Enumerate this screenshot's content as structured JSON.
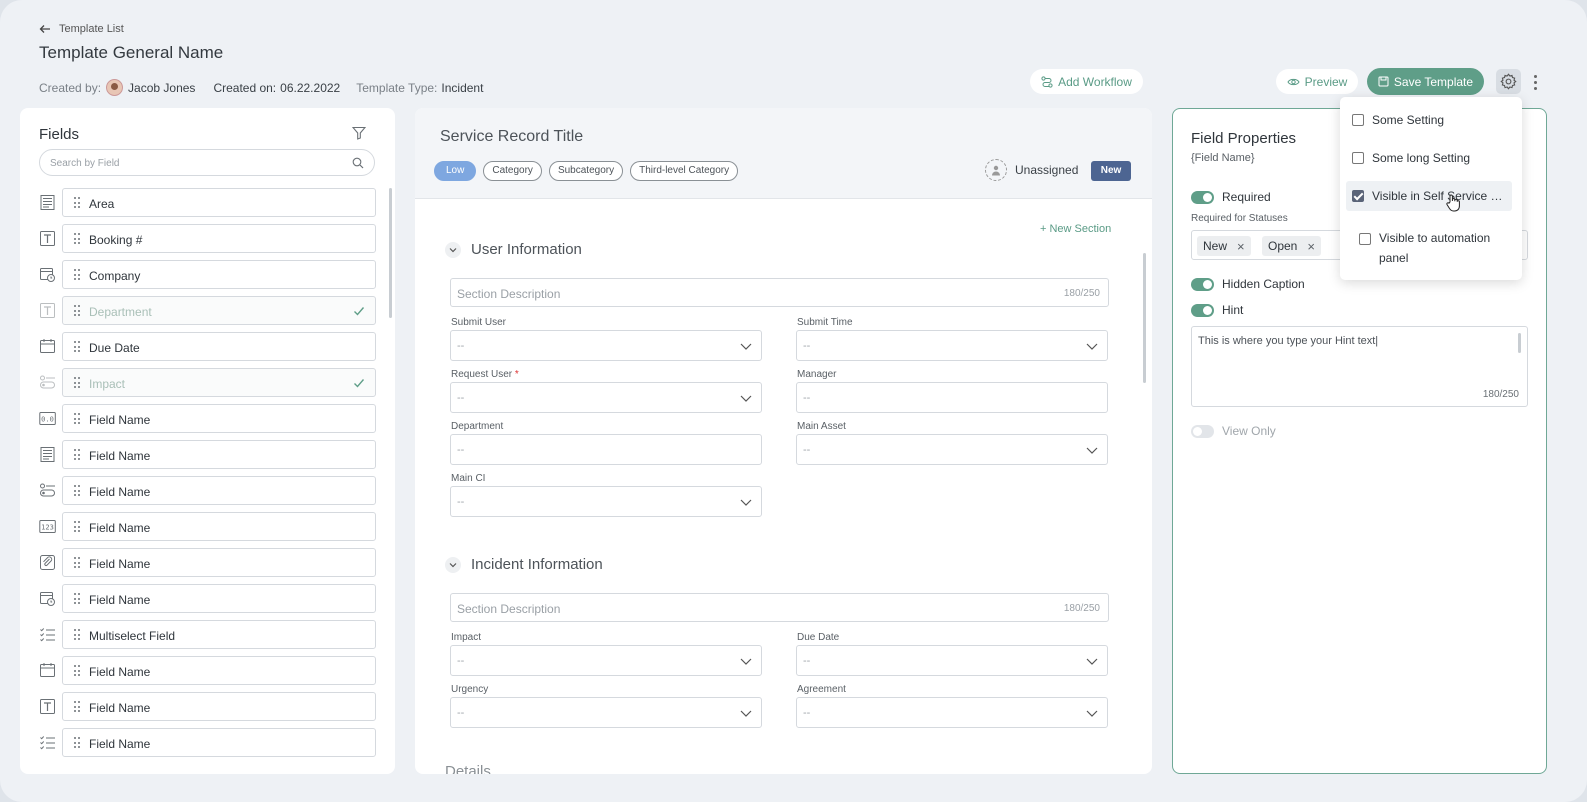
{
  "header": {
    "back_label": "Template List",
    "title": "Template General Name",
    "created_by_label": "Created by:",
    "created_by_name": "Jacob Jones",
    "created_on_label": "Created on:",
    "created_on_value": "06.22.2022",
    "type_label": "Template Type:",
    "type_value": "Incident",
    "add_workflow": "Add Workflow",
    "preview": "Preview",
    "save": "Save Template"
  },
  "fields_panel": {
    "title": "Fields",
    "search_placeholder": "Search by Field",
    "items": [
      {
        "label": "Area",
        "icon": "form-icon",
        "disabled": false
      },
      {
        "label": "Booking #",
        "icon": "text-icon",
        "disabled": false
      },
      {
        "label": "Company",
        "icon": "calendar-clock-icon",
        "disabled": false
      },
      {
        "label": "Department",
        "icon": "text-icon",
        "disabled": true
      },
      {
        "label": "Due Date",
        "icon": "calendar-icon",
        "disabled": false
      },
      {
        "label": "Impact",
        "icon": "list-select-icon",
        "disabled": true
      },
      {
        "label": "Field Name",
        "icon": "number-icon",
        "disabled": false
      },
      {
        "label": "Field Name",
        "icon": "form-icon",
        "disabled": false
      },
      {
        "label": "Field Name",
        "icon": "list-select-icon",
        "disabled": false
      },
      {
        "label": "Field Name",
        "icon": "123-icon",
        "disabled": false
      },
      {
        "label": "Field Name",
        "icon": "attachment-icon",
        "disabled": false
      },
      {
        "label": "Field Name",
        "icon": "calendar-clock-icon",
        "disabled": false
      },
      {
        "label": "Multiselect Field",
        "icon": "checklist-icon",
        "disabled": false
      },
      {
        "label": "Field Name",
        "icon": "calendar-icon",
        "disabled": false
      },
      {
        "label": "Field Name",
        "icon": "text-icon",
        "disabled": false
      },
      {
        "label": "Field Name",
        "icon": "checklist-icon",
        "disabled": false
      }
    ]
  },
  "record": {
    "title": "Service Record Title",
    "tags": [
      "Low",
      "Category",
      "Subcategory",
      "Third-level Category"
    ],
    "assignee": "Unassigned",
    "status": "New",
    "new_section": "New Section",
    "sections": [
      {
        "title": "User Information",
        "desc_placeholder": "Section Description",
        "desc_count": "180/250",
        "fields": [
          {
            "label": "Submit User",
            "value": "--",
            "dropdown": true,
            "required": false
          },
          {
            "label": "Submit Time",
            "value": "--",
            "dropdown": true,
            "required": false
          },
          {
            "label": "Request User",
            "value": "--",
            "dropdown": true,
            "required": true
          },
          {
            "label": "Manager",
            "value": "--",
            "dropdown": false,
            "required": false
          },
          {
            "label": "Department",
            "value": "--",
            "dropdown": false,
            "required": false
          },
          {
            "label": "Main Asset",
            "value": "--",
            "dropdown": true,
            "required": false
          },
          {
            "label": "Main CI",
            "value": "--",
            "dropdown": true,
            "required": false
          }
        ]
      },
      {
        "title": "Incident Information",
        "desc_placeholder": "Section Description",
        "desc_count": "180/250",
        "fields": [
          {
            "label": "Impact",
            "value": "--",
            "dropdown": true,
            "required": false
          },
          {
            "label": "Due Date",
            "value": "--",
            "dropdown": true,
            "required": false
          },
          {
            "label": "Urgency",
            "value": "--",
            "dropdown": true,
            "required": false
          },
          {
            "label": "Agreement",
            "value": "--",
            "dropdown": true,
            "required": false
          }
        ]
      }
    ],
    "next_section_peek": "Details"
  },
  "properties": {
    "title": "Field Properties",
    "subtitle": "{Field Name}",
    "required_label": "Required",
    "required_for_label": "Required for Statuses",
    "statuses": [
      "New",
      "Open"
    ],
    "hidden_caption_label": "Hidden Caption",
    "hint_label": "Hint",
    "hint_text": "This is where you type your Hint text",
    "hint_count": "180/250",
    "view_only_label": "View Only"
  },
  "settings_menu": {
    "items": [
      {
        "label": "Some Setting",
        "checked": false
      },
      {
        "label": "Some long Setting",
        "checked": false
      },
      {
        "label": "Visible in Self Service Portal",
        "checked": true
      },
      {
        "label": "Visible to automation panel",
        "checked": false
      }
    ]
  },
  "colors": {
    "accent": "#5f9e88",
    "status_new": "#4d6592",
    "tag_low": "#7ea7e0"
  }
}
